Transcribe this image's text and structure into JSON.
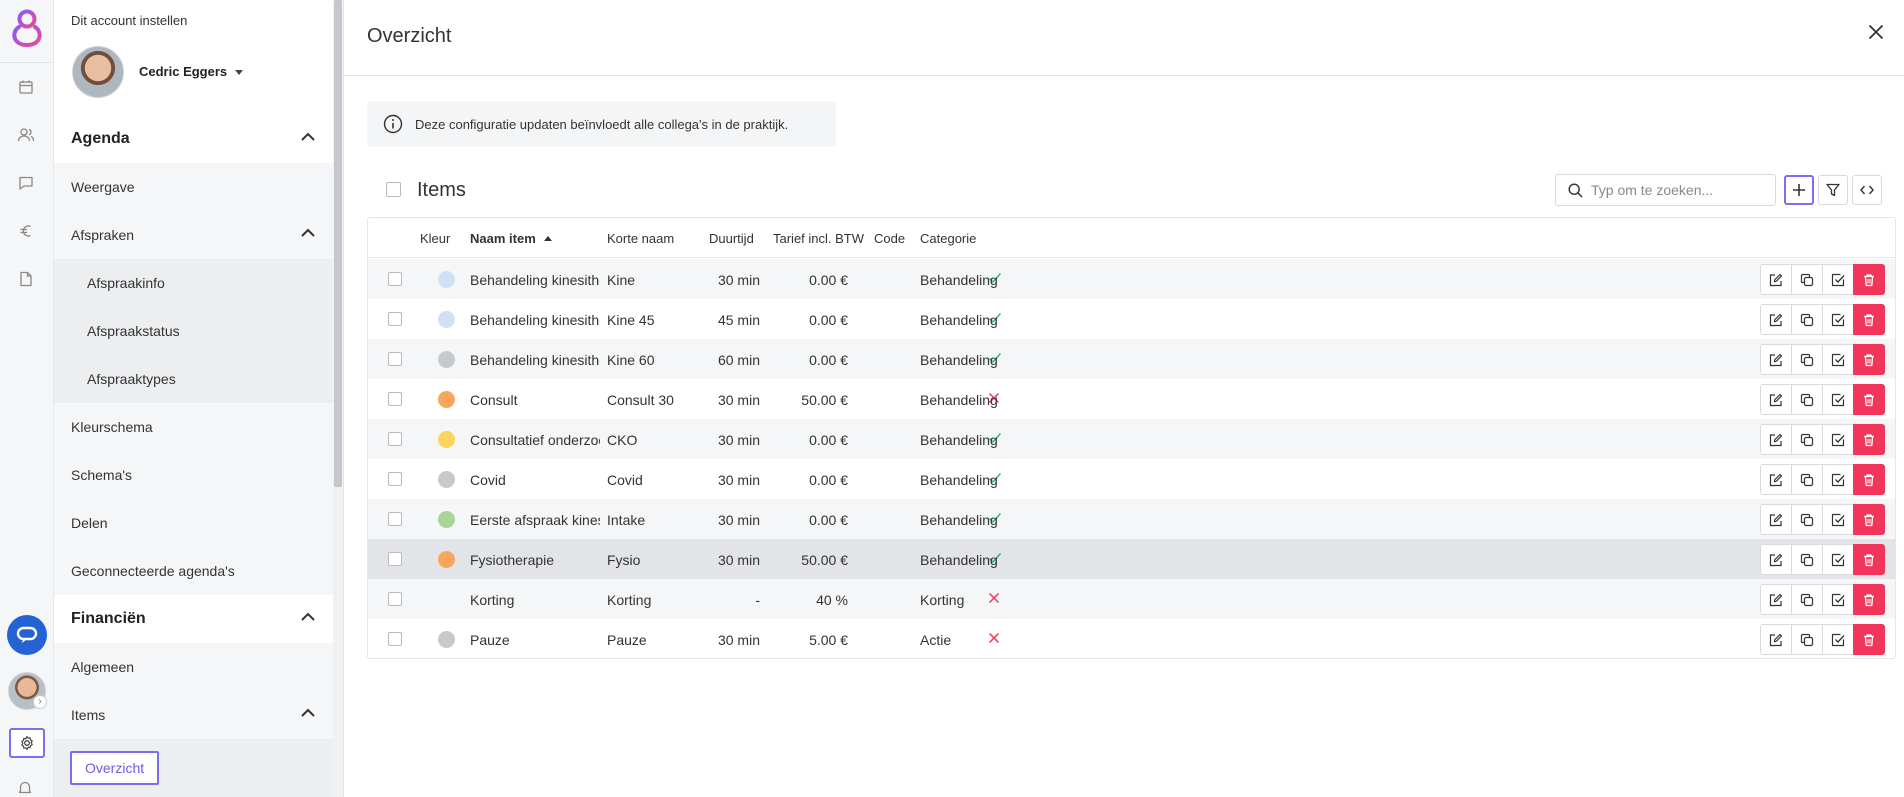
{
  "rail": {
    "icons": [
      "calendar-icon",
      "users-icon",
      "chat-icon",
      "euro-icon",
      "document-icon"
    ]
  },
  "sidebar": {
    "account_label": "Dit account instellen",
    "user_name": "Cedric Eggers",
    "nav": [
      {
        "label": "Agenda",
        "level": "section",
        "expanded": true
      },
      {
        "label": "Weergave",
        "level": "l1"
      },
      {
        "label": "Afspraken",
        "level": "l1",
        "expanded": true
      },
      {
        "label": "Afspraakinfo",
        "level": "l2"
      },
      {
        "label": "Afspraakstatus",
        "level": "l2"
      },
      {
        "label": "Afspraaktypes",
        "level": "l2"
      },
      {
        "label": "Kleurschema",
        "level": "l1"
      },
      {
        "label": "Schema's",
        "level": "l1"
      },
      {
        "label": "Delen",
        "level": "l1"
      },
      {
        "label": "Geconnecteerde agenda's",
        "level": "l1"
      },
      {
        "label": "Financiën",
        "level": "section",
        "expanded": true
      },
      {
        "label": "Algemeen",
        "level": "l1"
      },
      {
        "label": "Items",
        "level": "l1",
        "expanded": true
      },
      {
        "label": "Overzicht",
        "level": "l2",
        "active": true
      }
    ]
  },
  "main": {
    "title": "Overzicht",
    "info_text": "Deze configuratie updaten beïnvloedt alle collega's in de praktijk.",
    "items_title": "Items",
    "search_placeholder": "Typ om te zoeken...",
    "columns": {
      "color": "Kleur",
      "name": "Naam item",
      "short": "Korte naam",
      "duration": "Duurtijd",
      "price": "Tarief incl. BTW",
      "code": "Code",
      "category": "Categorie"
    },
    "accent_color": "#7b6ef0",
    "delete_color": "#f0365a",
    "rows": [
      {
        "color": "#cfe2f5",
        "name": "Behandeling kinesithe...",
        "short": "Kine",
        "duration": "30 min",
        "price": "0.00 €",
        "code": "check",
        "category": "Behandeling"
      },
      {
        "color": "#cfe2f5",
        "name": "Behandeling kinesithe...",
        "short": "Kine 45",
        "duration": "45 min",
        "price": "0.00 €",
        "code": "check",
        "category": "Behandeling"
      },
      {
        "color": "#c7c9cc",
        "name": "Behandeling kinesithe...",
        "short": "Kine 60",
        "duration": "60 min",
        "price": "0.00 €",
        "code": "check",
        "category": "Behandeling"
      },
      {
        "color": "#f7a65a",
        "name": "Consult",
        "short": "Consult 30",
        "duration": "30 min",
        "price": "50.00 €",
        "code": "cross",
        "category": "Behandeling"
      },
      {
        "color": "#fad45c",
        "name": "Consultatief onderzoek",
        "short": "CKO",
        "duration": "30 min",
        "price": "0.00 €",
        "code": "check",
        "category": "Behandeling"
      },
      {
        "color": "#c7c9cc",
        "name": "Covid",
        "short": "Covid",
        "duration": "30 min",
        "price": "0.00 €",
        "code": "check",
        "category": "Behandeling"
      },
      {
        "color": "#a9d59a",
        "name": "Eerste afspraak kinesi...",
        "short": "Intake",
        "duration": "30 min",
        "price": "0.00 €",
        "code": "check",
        "category": "Behandeling"
      },
      {
        "color": "#f7a65a",
        "name": "Fysiotherapie",
        "short": "Fysio",
        "duration": "30 min",
        "price": "50.00 €",
        "code": "check",
        "category": "Behandeling",
        "highlight": true
      },
      {
        "color": "",
        "name": "Korting",
        "short": "Korting",
        "duration": "-",
        "price": "40 %",
        "code": "cross",
        "category": "Korting"
      },
      {
        "color": "#c7c9cc",
        "name": "Pauze",
        "short": "Pauze",
        "duration": "30 min",
        "price": "5.00 €",
        "code": "cross",
        "category": "Actie"
      }
    ]
  }
}
